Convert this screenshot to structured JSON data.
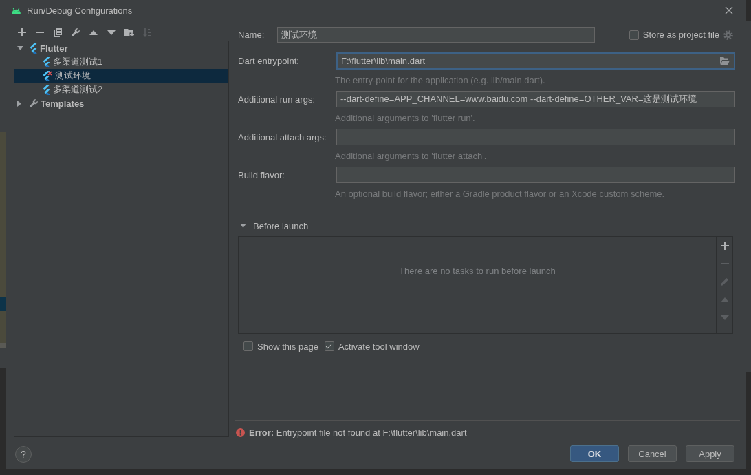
{
  "window": {
    "title": "Run/Debug Configurations"
  },
  "toolbar": [
    {
      "kind": "add",
      "disabled": false
    },
    {
      "kind": "remove",
      "disabled": false
    },
    {
      "kind": "copy",
      "disabled": false
    },
    {
      "kind": "edit",
      "disabled": false
    },
    {
      "kind": "up",
      "disabled": false
    },
    {
      "kind": "down",
      "disabled": false
    },
    {
      "kind": "folder",
      "disabled": false
    },
    {
      "kind": "sort",
      "disabled": true
    }
  ],
  "tree": [
    {
      "label": "Flutter",
      "kind": "flutter",
      "expanded": true,
      "selected": false,
      "children": [
        {
          "label": "多渠道测试1",
          "kind": "flutter",
          "error": false,
          "selected": false
        },
        {
          "label": "测试环境",
          "kind": "flutter",
          "error": true,
          "selected": true
        },
        {
          "label": "多渠道测试2",
          "kind": "flutter",
          "error": false,
          "selected": false
        }
      ]
    },
    {
      "label": "Templates",
      "kind": "template",
      "expanded": false,
      "selected": false
    }
  ],
  "name": {
    "label": "Name:",
    "value": "测试环境"
  },
  "store_as_project_file": {
    "label": "Store as project file",
    "checked": false
  },
  "fields": [
    {
      "label": "Dart entrypoint:",
      "kind": "file",
      "value": "F:\\flutter\\lib\\main.dart",
      "focused": true,
      "hint": "The entry-point for the application (e.g. lib/main.dart)."
    },
    {
      "label": "Additional run args:",
      "kind": "text",
      "value": "--dart-define=APP_CHANNEL=www.baidu.com --dart-define=OTHER_VAR=这是测试环境",
      "focused": false,
      "hint": "Additional arguments to 'flutter run'."
    },
    {
      "label": "Additional attach args:",
      "kind": "text",
      "focused": false,
      "hint": "Additional arguments to 'flutter attach'."
    },
    {
      "label": "Build flavor:",
      "kind": "text",
      "focused": false,
      "hint": "An optional build flavor; either a Gradle product flavor or an Xcode custom scheme."
    }
  ],
  "before_launch": {
    "title": "Before launch",
    "expanded": true,
    "empty_text": "There are no tasks to run before launch",
    "tools": [
      {
        "kind": "add",
        "disabled": false
      },
      {
        "kind": "remove",
        "disabled": true
      },
      {
        "kind": "edit",
        "disabled": true
      },
      {
        "kind": "up",
        "disabled": true
      },
      {
        "kind": "down",
        "disabled": true
      }
    ]
  },
  "options": [
    {
      "label": "Show this page",
      "checked": false
    },
    {
      "label": "Activate tool window",
      "checked": true
    }
  ],
  "error": "**Error:** Entrypoint file not found at F:\\flutter\\lib\\main.dart",
  "help": {
    "label": "?"
  },
  "buttons": [
    {
      "label": "OK",
      "default": true
    },
    {
      "label": "Cancel",
      "default": false
    },
    {
      "label": "Apply",
      "default": false
    }
  ]
}
